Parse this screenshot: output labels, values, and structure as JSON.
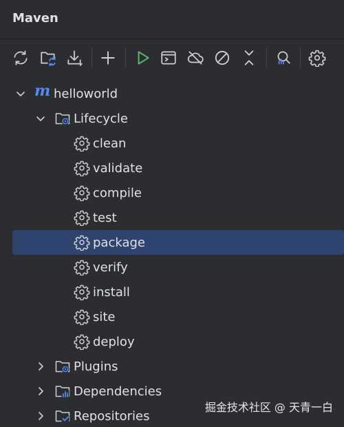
{
  "panel": {
    "title": "Maven"
  },
  "toolbar": {
    "buttons": [
      {
        "icon": "reload-icon"
      },
      {
        "icon": "generate-sources-icon"
      },
      {
        "icon": "download-icon"
      },
      {
        "icon": "add-icon"
      },
      {
        "icon": "run-icon"
      },
      {
        "icon": "execute-goal-icon"
      },
      {
        "icon": "offline-icon"
      },
      {
        "icon": "skip-tests-icon"
      },
      {
        "icon": "collapse-all-icon"
      },
      {
        "icon": "analyze-dependencies-icon"
      },
      {
        "icon": "settings-icon"
      }
    ]
  },
  "tree": {
    "project": {
      "name": "helloworld",
      "logo": "m"
    },
    "lifecycle": {
      "label": "Lifecycle",
      "goals": [
        "clean",
        "validate",
        "compile",
        "test",
        "package",
        "verify",
        "install",
        "site",
        "deploy"
      ],
      "selected": "package"
    },
    "plugins": {
      "label": "Plugins"
    },
    "dependencies": {
      "label": "Dependencies"
    },
    "repositories": {
      "label": "Repositories"
    }
  },
  "watermark": "掘金技术社区 @ 天青一白",
  "colors": {
    "background": "#2b2d30",
    "selection": "#2e436e",
    "run_green": "#5fb865",
    "maven_blue": "#548af7"
  }
}
